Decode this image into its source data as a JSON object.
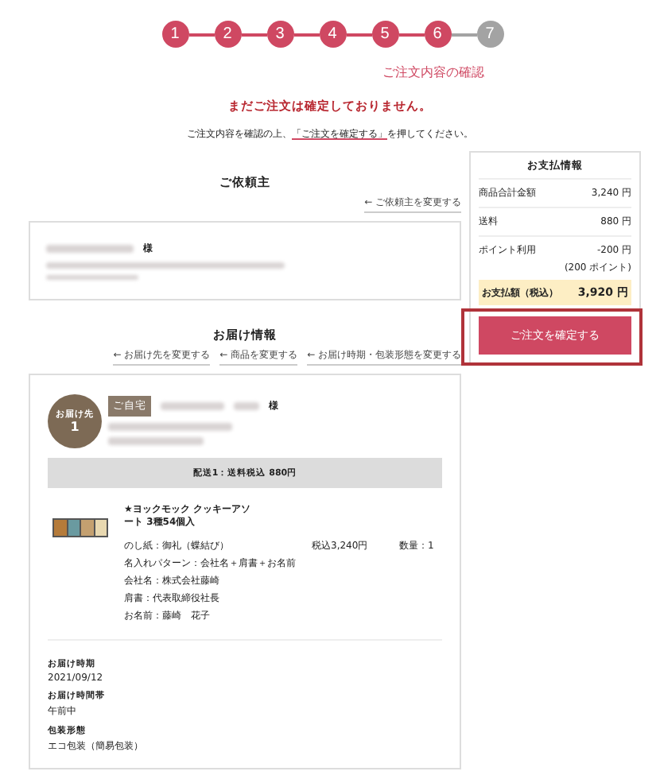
{
  "steps": [
    {
      "number": "1",
      "done": true
    },
    {
      "number": "2",
      "done": true
    },
    {
      "number": "3",
      "done": true
    },
    {
      "number": "4",
      "done": true
    },
    {
      "number": "5",
      "done": true
    },
    {
      "number": "6",
      "done": true,
      "label": "ご注文内容の確認"
    },
    {
      "number": "7",
      "done": false
    }
  ],
  "notice": {
    "warning": "まだご注文は確定しておりません。",
    "before": "ご注文内容を確認の上、",
    "link": "「ご注文を確定する」",
    "after": "を押してください。"
  },
  "requester": {
    "heading": "ご依頼主",
    "change_link": "← ご依頼主を変更する",
    "honorific": "様"
  },
  "delivery": {
    "heading": "お届け情報",
    "links": [
      "← お届け先を変更する",
      "← 商品を変更する",
      "← お届け時期・包装形態を変更する"
    ],
    "badge_label": "お届け先",
    "badge_number": "1",
    "tag": "ご自宅",
    "honorific": "様",
    "shipping": "配送1：送料税込 880円",
    "product": {
      "name": "★ヨックモック クッキーアソート 3種54個入",
      "options": [
        "のし紙：御礼（蝶結び）",
        "名入れパターン：会社名＋肩書＋お名前",
        "会社名：株式会社藤崎",
        "肩書：代表取締役社長",
        "お名前：藤崎　花子"
      ],
      "price": "税込3,240円",
      "quantity": "数量：1"
    },
    "details": [
      {
        "label": "お届け時期",
        "value": "2021/09/12"
      },
      {
        "label": "お届け時間帯",
        "value": "午前中"
      },
      {
        "label": "包装形態",
        "value": "エコ包装（簡易包装）"
      }
    ]
  },
  "payment": {
    "heading": "お支払情報",
    "rows": [
      {
        "label": "商品合計金額",
        "amount": "3,240 円"
      },
      {
        "label": "送料",
        "amount": "880 円"
      },
      {
        "label": "ポイント利用",
        "amount": "-200 円",
        "note": "(200 ポイント)"
      }
    ],
    "total_label": "お支払額（税込）",
    "total_amount": "3,920 円",
    "confirm_button": "ご注文を確定する",
    "highlighted": true
  }
}
